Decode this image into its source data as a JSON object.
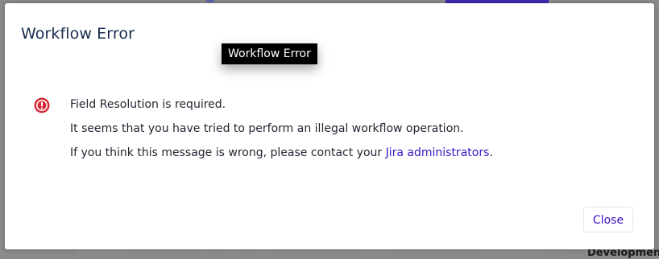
{
  "dialog": {
    "title": "Workflow Error",
    "tooltip": "Workflow Error",
    "icon": "error-circle-icon",
    "messages": {
      "line1": "Field Resolution is required.",
      "line2": "It seems that you have tried to perform an illegal workflow operation.",
      "line3_prefix": "If you think this message is wrong, please contact your ",
      "line3_link": "Jira administrators",
      "line3_suffix": "."
    },
    "close_label": "Close"
  },
  "background": {
    "section_label": "Development"
  },
  "colors": {
    "error": "#d62a36",
    "link": "#3b12c9",
    "title": "#172b4d",
    "tooltip_bg": "#000000"
  }
}
